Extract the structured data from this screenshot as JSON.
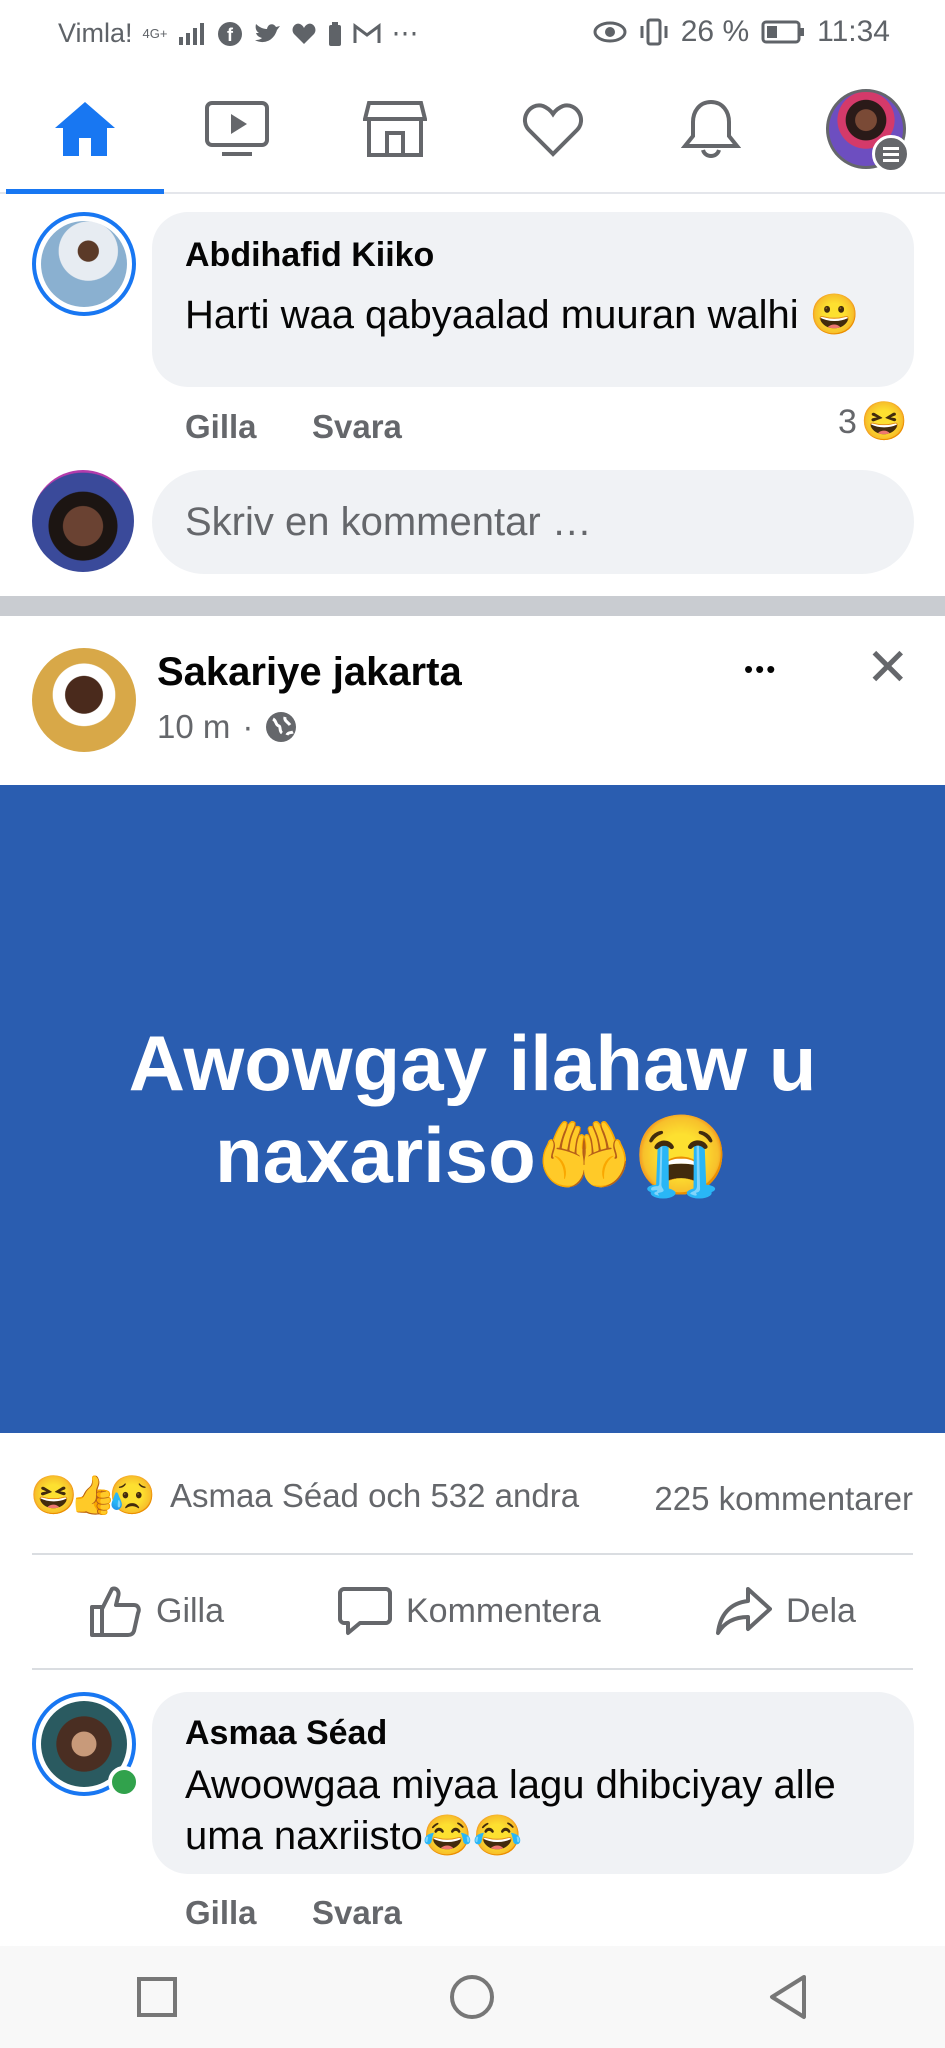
{
  "status": {
    "carrier": "Vimla!",
    "network": "4G+",
    "battery_pct": "26 %",
    "time": "11:34"
  },
  "nav": {
    "tabs": [
      {
        "icon": "home-icon",
        "active": true
      },
      {
        "icon": "watch-icon",
        "active": false
      },
      {
        "icon": "marketplace-icon",
        "active": false
      },
      {
        "icon": "dating-heart-icon",
        "active": false
      },
      {
        "icon": "notifications-bell-icon",
        "active": false
      },
      {
        "icon": "profile-menu-icon",
        "active": false
      }
    ]
  },
  "comment1": {
    "author": "Abdihafid Kiiko",
    "text": "Harti waa qabyaalad muuran walhi 😀",
    "like": "Gilla",
    "reply": "Svara",
    "reaction_count": "3",
    "reaction_emoji": "😆"
  },
  "composer": {
    "placeholder": "Skriv en kommentar …"
  },
  "post": {
    "author": "Sakariye jakarta",
    "time": "10 m",
    "separator": "·",
    "more": "•••",
    "close": "✕",
    "text": "Awowgay ilahaw u naxariso🤲😭",
    "reactions_emojis": "😆👍😥",
    "reactions_summary": "Asmaa Séad och 532 andra",
    "comments_count": "225 kommentarer",
    "actions": {
      "like": "Gilla",
      "comment": "Kommentera",
      "share": "Dela"
    },
    "bg_color": "#2a5db0"
  },
  "comment2": {
    "author": "Asmaa Séad",
    "text": "Awoowgaa miyaa lagu dhibciyay alle uma naxriisto😂😂",
    "like": "Gilla",
    "reply": "Svara"
  }
}
